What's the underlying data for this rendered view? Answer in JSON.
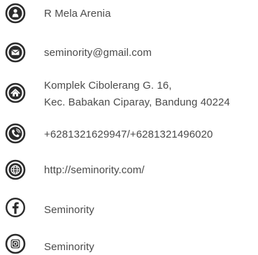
{
  "contact": {
    "name": {
      "icon": "user-circle-icon",
      "text": "R Mela Arenia"
    },
    "email": {
      "icon": "envelope-circle-icon",
      "text": "seminority@gmail.com"
    },
    "address": {
      "icon": "home-circle-icon",
      "line1": "Komplek Cibolerang G. 16,",
      "line2": "Kec. Babakan Ciparay, Bandung 40224"
    },
    "phone": {
      "icon": "phone-circle-icon",
      "text": "+6281321629947/+6281321496020"
    },
    "website": {
      "icon": "globe-circle-icon",
      "text": "http://seminority.com/"
    },
    "facebook": {
      "icon": "facebook-circle-icon",
      "text": "Seminority"
    },
    "instagram": {
      "icon": "instagram-circle-icon",
      "text": "Seminority"
    }
  },
  "colors": {
    "icon": "#2b2b2b",
    "text": "#4a4a4a",
    "background": "#ffffff"
  }
}
